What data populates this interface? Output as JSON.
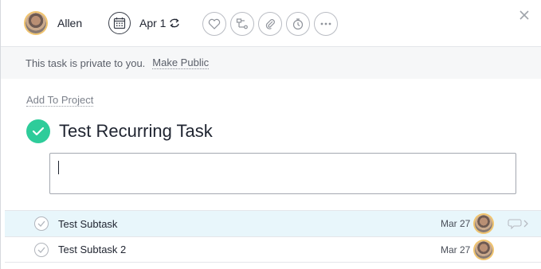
{
  "toolbar": {
    "assignee_name": "Allen",
    "due_date": "Apr 1",
    "icons": [
      "heart-icon",
      "dependency-icon",
      "paperclip-icon",
      "stopwatch-icon",
      "more-icon"
    ]
  },
  "banner": {
    "text": "This task is private to you.",
    "link": "Make Public"
  },
  "add_to_project": "Add To Project",
  "task": {
    "title": "Test Recurring Task",
    "description": ""
  },
  "subtasks": [
    {
      "name": "Test Subtask",
      "date": "Mar 27"
    },
    {
      "name": "Test Subtask 2",
      "date": "Mar 27"
    }
  ],
  "colors": {
    "complete_green": "#2ecc9a",
    "active_row": "#e8f6fb",
    "avatar_ring": "#f0c36d"
  }
}
